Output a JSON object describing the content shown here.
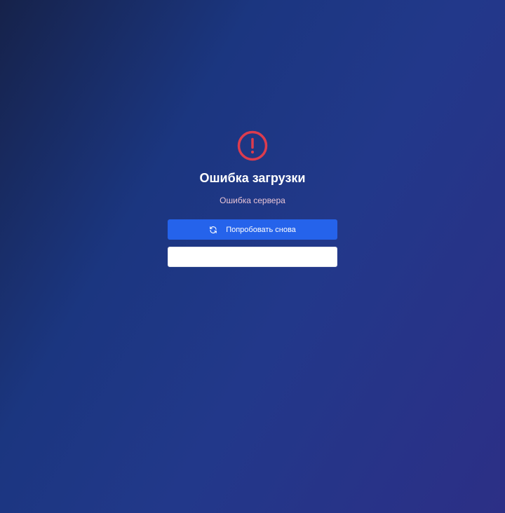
{
  "error": {
    "icon": "alert-circle-icon",
    "title": "Ошибка загрузки",
    "message": "Ошибка сервера"
  },
  "actions": {
    "retry_label": "Попробовать снова",
    "retry_icon": "refresh-icon",
    "secondary_label": ""
  },
  "colors": {
    "error_accent": "#dc3c4e",
    "primary_button": "#2563eb",
    "message_text": "#e8c4d6"
  }
}
